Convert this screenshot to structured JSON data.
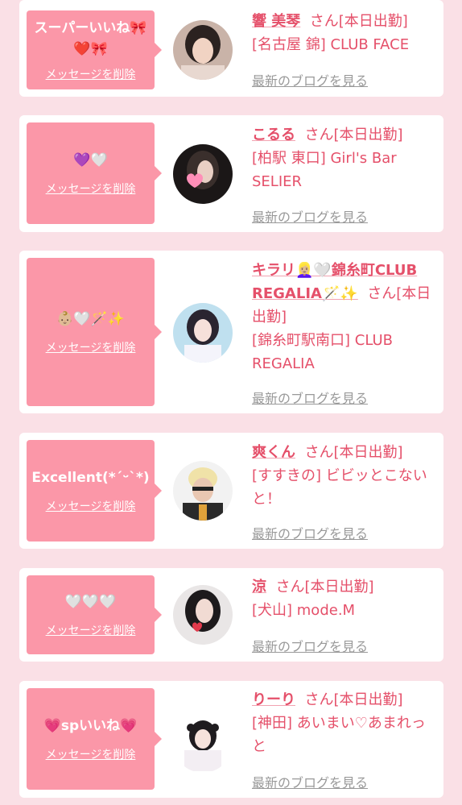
{
  "cards": [
    {
      "message": "スーパーいいね🎀❤️🎀",
      "delete_label": "メッセージを削除",
      "name": "響 美琴",
      "suffix": "さん[本日出勤]",
      "shop": "[名古屋 錦] CLUB FACE",
      "blog_label": "最新のブログを見る"
    },
    {
      "message": "💜🤍",
      "delete_label": "メッセージを削除",
      "name": "こるる",
      "suffix": "さん[本日出勤]",
      "shop": "[柏駅 東口] Girl's Bar SELIER",
      "blog_label": "最新のブログを見る"
    },
    {
      "message": "👶🏼🤍🪄✨",
      "delete_label": "メッセージを削除",
      "name": "キラリ👱🏼‍♀️🤍錦糸町CLUB REGALIA🪄✨",
      "suffix": "さん[本日出勤]",
      "shop": "[錦糸町駅南口] CLUB REGALIA",
      "blog_label": "最新のブログを見る"
    },
    {
      "message": "Excellent(*ˊᵕˋ*)",
      "delete_label": "メッセージを削除",
      "name": "爽くん",
      "suffix": "さん[本日出勤]",
      "shop": "[すすきの] ビビッとこないと！",
      "blog_label": "最新のブログを見る"
    },
    {
      "message": "🤍🤍🤍",
      "delete_label": "メッセージを削除",
      "name": "涼",
      "suffix": "さん[本日出勤]",
      "shop": "[犬山] mode.M",
      "blog_label": "最新のブログを見る"
    },
    {
      "message": "💗spいいね💗",
      "delete_label": "メッセージを削除",
      "name": "りーり",
      "suffix": "さん[本日出勤]",
      "shop": "[神田] あいまい♡あまれっと",
      "blog_label": "最新のブログを見る"
    }
  ],
  "colors": {
    "page_bg": "#fae0e6",
    "bubble": "#fb97a8",
    "accent": "#e5506a",
    "link_gray": "#999999"
  }
}
